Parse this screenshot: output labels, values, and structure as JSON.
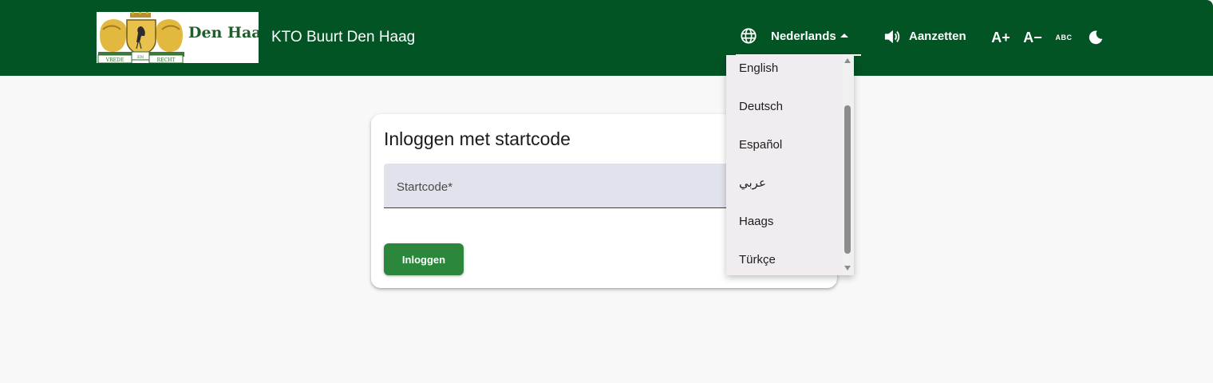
{
  "header": {
    "logo_text": "Den Haag",
    "logo_motto": [
      "VREDE",
      "EN",
      "RECHT"
    ],
    "app_title": "KTO Buurt Den Haag",
    "language_selected": "Nederlands",
    "speak_label": "Aanzetten",
    "font_increase_label": "A+",
    "font_decrease_label": "A−",
    "dyslexia_label": "ABC",
    "colors": {
      "header_bg": "#035425",
      "accent": "#2a873c"
    }
  },
  "language_menu": {
    "options": [
      "English",
      "Deutsch",
      "Español",
      "عربي",
      "Haags",
      "Türkçe"
    ]
  },
  "login_card": {
    "title": "Inloggen met startcode",
    "field_label": "Startcode*",
    "field_value": "",
    "submit_label": "Inloggen"
  }
}
